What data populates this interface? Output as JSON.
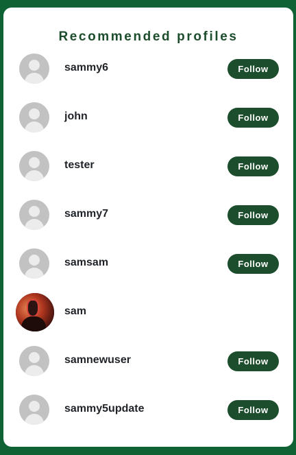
{
  "title": "Recommended profiles",
  "follow_label": "Follow",
  "colors": {
    "page_background": "#0e6234",
    "card_background": "#ffffff",
    "accent": "#1c4d2c",
    "placeholder_avatar": "#c2c2c2"
  },
  "profiles": [
    {
      "username": "sammy6",
      "avatar": "default-avatar-icon",
      "show_follow": true
    },
    {
      "username": "john",
      "avatar": "default-avatar-icon",
      "show_follow": true
    },
    {
      "username": "tester",
      "avatar": "default-avatar-icon",
      "show_follow": true
    },
    {
      "username": "sammy7",
      "avatar": "default-avatar-icon",
      "show_follow": true
    },
    {
      "username": "samsam",
      "avatar": "default-avatar-icon",
      "show_follow": true
    },
    {
      "username": "sam",
      "avatar": "profile-photo",
      "show_follow": false
    },
    {
      "username": "samnewuser",
      "avatar": "default-avatar-icon",
      "show_follow": true
    },
    {
      "username": "sammy5update",
      "avatar": "default-avatar-icon",
      "show_follow": true
    }
  ]
}
